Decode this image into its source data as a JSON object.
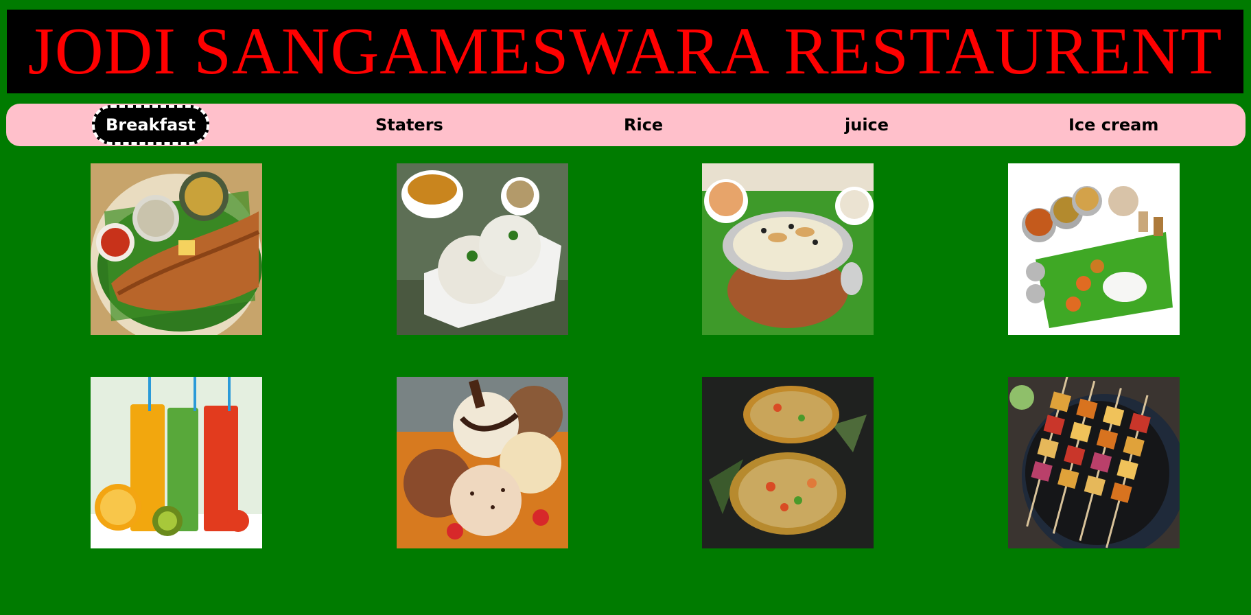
{
  "header": {
    "title": "JODI SANGAMESWARA RESTAURENT"
  },
  "nav": {
    "items": [
      {
        "label": "Breakfast",
        "active": true
      },
      {
        "label": "Staters",
        "active": false
      },
      {
        "label": "Rice",
        "active": false
      },
      {
        "label": "juice",
        "active": false
      },
      {
        "label": "Ice cream",
        "active": false
      }
    ]
  },
  "gallery": {
    "images": [
      {
        "name": "dosa-image"
      },
      {
        "name": "idli-image"
      },
      {
        "name": "pongal-image"
      },
      {
        "name": "thali-image"
      },
      {
        "name": "juice-image"
      },
      {
        "name": "ice-cream-image"
      },
      {
        "name": "pineapple-rice-image"
      },
      {
        "name": "paneer-tikka-image"
      }
    ]
  },
  "colors": {
    "background": "#007b00",
    "header_bg": "#000000",
    "title": "#ff0000",
    "nav_bg": "#ffc0cb"
  }
}
